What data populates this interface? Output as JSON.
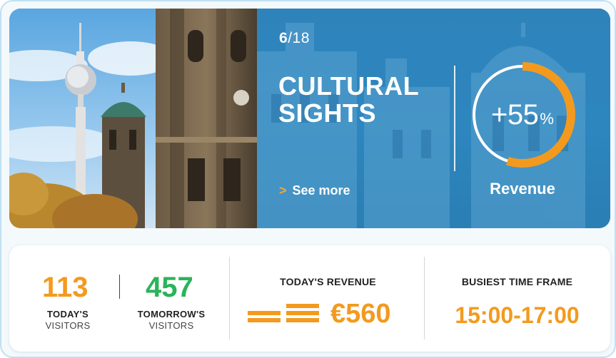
{
  "hero": {
    "counter_current": "6",
    "counter_total": "/18",
    "category_title": "CULTURAL SIGHTS",
    "see_more": "See more",
    "see_more_chevron": ">",
    "gauge": {
      "value_text": "+55",
      "unit": "%",
      "fraction": 0.55,
      "label": "Revenue",
      "arc_color": "#f39a1e",
      "track_color": "#ffffff"
    }
  },
  "stats": {
    "today_visitors": {
      "value": "113",
      "label_line1": "TODAY'S",
      "label_line2": "VISITORS",
      "color": "#f39a1e"
    },
    "tomorrow_visitors": {
      "value": "457",
      "label_line1": "TOMORROW'S",
      "label_line2": "VISITORS",
      "color": "#2bb35a"
    },
    "todays_revenue": {
      "heading": "TODAY'S REVENUE",
      "value": "€560"
    },
    "busiest_time": {
      "heading": "BUSIEST TIME FRAME",
      "value": "15:00-17:00"
    }
  },
  "colors": {
    "accent_orange": "#f39a1e",
    "accent_green": "#2bb35a",
    "hero_blue": "#2f83bb"
  }
}
